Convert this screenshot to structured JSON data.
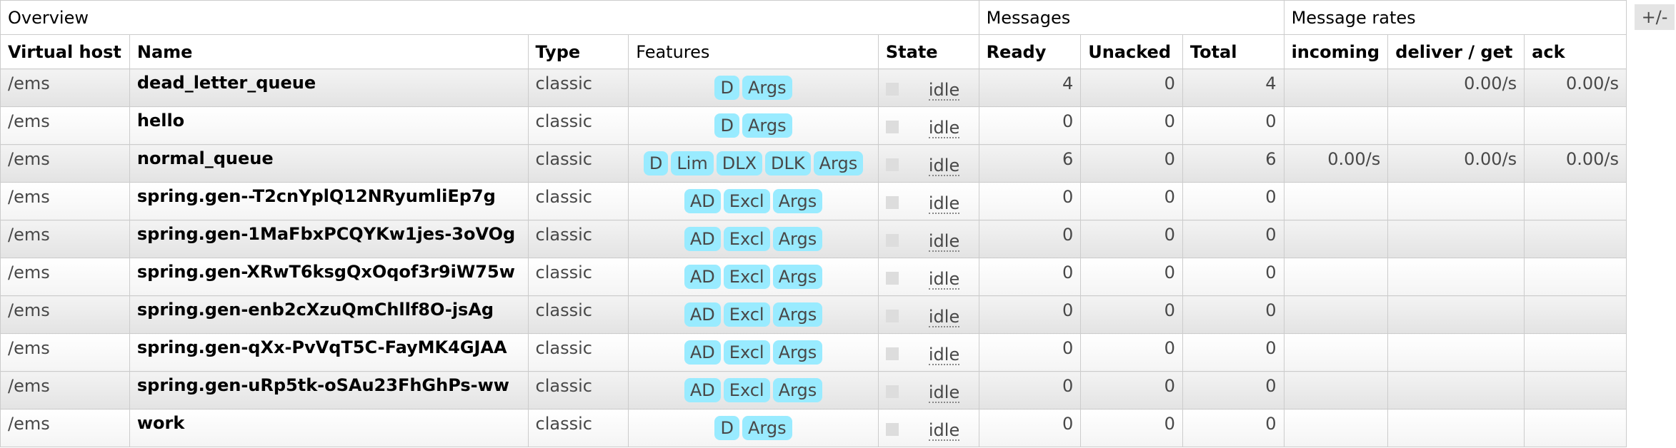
{
  "groups": {
    "overview": "Overview",
    "messages": "Messages",
    "message_rates": "Message rates"
  },
  "toggle_label": "+/-",
  "columns": {
    "vhost": "Virtual host",
    "name": "Name",
    "type": "Type",
    "features": "Features",
    "state": "State",
    "ready": "Ready",
    "unacked": "Unacked",
    "total": "Total",
    "incoming": "incoming",
    "deliver_get": "deliver / get",
    "ack": "ack"
  },
  "rows": [
    {
      "vhost": "/ems",
      "name": "dead_letter_queue",
      "type": "classic",
      "features": [
        "D",
        "Args"
      ],
      "state": "idle",
      "ready": "4",
      "unacked": "0",
      "total": "4",
      "incoming": "",
      "deliver_get": "0.00/s",
      "ack": "0.00/s"
    },
    {
      "vhost": "/ems",
      "name": "hello",
      "type": "classic",
      "features": [
        "D",
        "Args"
      ],
      "state": "idle",
      "ready": "0",
      "unacked": "0",
      "total": "0",
      "incoming": "",
      "deliver_get": "",
      "ack": ""
    },
    {
      "vhost": "/ems",
      "name": "normal_queue",
      "type": "classic",
      "features": [
        "D",
        "Lim",
        "DLX",
        "DLK",
        "Args"
      ],
      "state": "idle",
      "ready": "6",
      "unacked": "0",
      "total": "6",
      "incoming": "0.00/s",
      "deliver_get": "0.00/s",
      "ack": "0.00/s"
    },
    {
      "vhost": "/ems",
      "name": "spring.gen--T2cnYplQ12NRyumliEp7g",
      "type": "classic",
      "features": [
        "AD",
        "Excl",
        "Args"
      ],
      "state": "idle",
      "ready": "0",
      "unacked": "0",
      "total": "0",
      "incoming": "",
      "deliver_get": "",
      "ack": ""
    },
    {
      "vhost": "/ems",
      "name": "spring.gen-1MaFbxPCQYKw1jes-3oVOg",
      "type": "classic",
      "features": [
        "AD",
        "Excl",
        "Args"
      ],
      "state": "idle",
      "ready": "0",
      "unacked": "0",
      "total": "0",
      "incoming": "",
      "deliver_get": "",
      "ack": ""
    },
    {
      "vhost": "/ems",
      "name": "spring.gen-XRwT6ksgQxOqof3r9iW75w",
      "type": "classic",
      "features": [
        "AD",
        "Excl",
        "Args"
      ],
      "state": "idle",
      "ready": "0",
      "unacked": "0",
      "total": "0",
      "incoming": "",
      "deliver_get": "",
      "ack": ""
    },
    {
      "vhost": "/ems",
      "name": "spring.gen-enb2cXzuQmChllf8O-jsAg",
      "type": "classic",
      "features": [
        "AD",
        "Excl",
        "Args"
      ],
      "state": "idle",
      "ready": "0",
      "unacked": "0",
      "total": "0",
      "incoming": "",
      "deliver_get": "",
      "ack": ""
    },
    {
      "vhost": "/ems",
      "name": "spring.gen-qXx-PvVqT5C-FayMK4GJAA",
      "type": "classic",
      "features": [
        "AD",
        "Excl",
        "Args"
      ],
      "state": "idle",
      "ready": "0",
      "unacked": "0",
      "total": "0",
      "incoming": "",
      "deliver_get": "",
      "ack": ""
    },
    {
      "vhost": "/ems",
      "name": "spring.gen-uRp5tk-oSAu23FhGhPs-ww",
      "type": "classic",
      "features": [
        "AD",
        "Excl",
        "Args"
      ],
      "state": "idle",
      "ready": "0",
      "unacked": "0",
      "total": "0",
      "incoming": "",
      "deliver_get": "",
      "ack": ""
    },
    {
      "vhost": "/ems",
      "name": "work",
      "type": "classic",
      "features": [
        "D",
        "Args"
      ],
      "state": "idle",
      "ready": "0",
      "unacked": "0",
      "total": "0",
      "incoming": "",
      "deliver_get": "",
      "ack": ""
    }
  ],
  "colors": {
    "badge": "#99ebff",
    "border": "#cccccc",
    "row_stripe": "#e8e8e8"
  }
}
